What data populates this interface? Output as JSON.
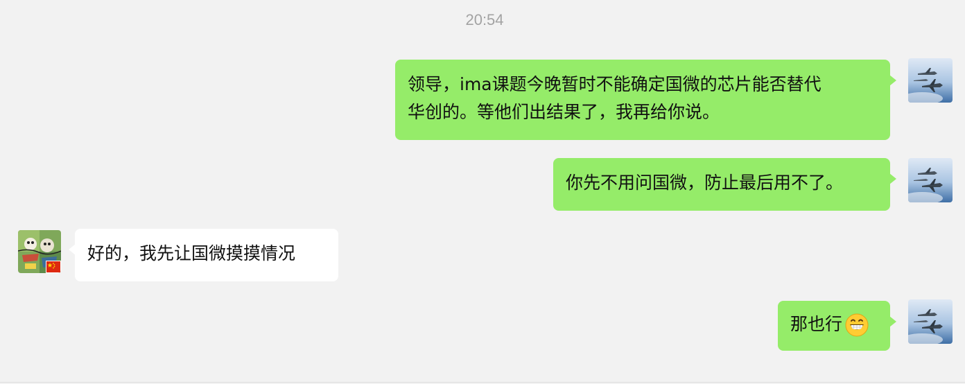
{
  "chat": {
    "timestamp": "20:54",
    "messages": [
      {
        "sender": "self",
        "lines": [
          "领导，ima课题今晚暂时不能确定国微的芯片能否替代",
          "华创的。等他们出结果了，我再给你说。"
        ]
      },
      {
        "sender": "self",
        "lines": [
          "你先不用问国微，防止最后用不了。"
        ]
      },
      {
        "sender": "other",
        "lines": [
          "好的，我先让国微摸摸情况"
        ]
      },
      {
        "sender": "self",
        "lines": [
          "那也行"
        ],
        "emoji": "grinning-face-emoji"
      }
    ]
  },
  "colors": {
    "background": "#f2f2f2",
    "outgoing_bubble": "#95ec69",
    "incoming_bubble": "#ffffff",
    "timestamp": "#a3a3a3"
  },
  "icons": {
    "self_avatar": "fighter-jets-sky-avatar",
    "other_avatar": "cartoon-art-avatar",
    "flag": "china-flag-badge",
    "emoji": "grinning-face-emoji"
  }
}
